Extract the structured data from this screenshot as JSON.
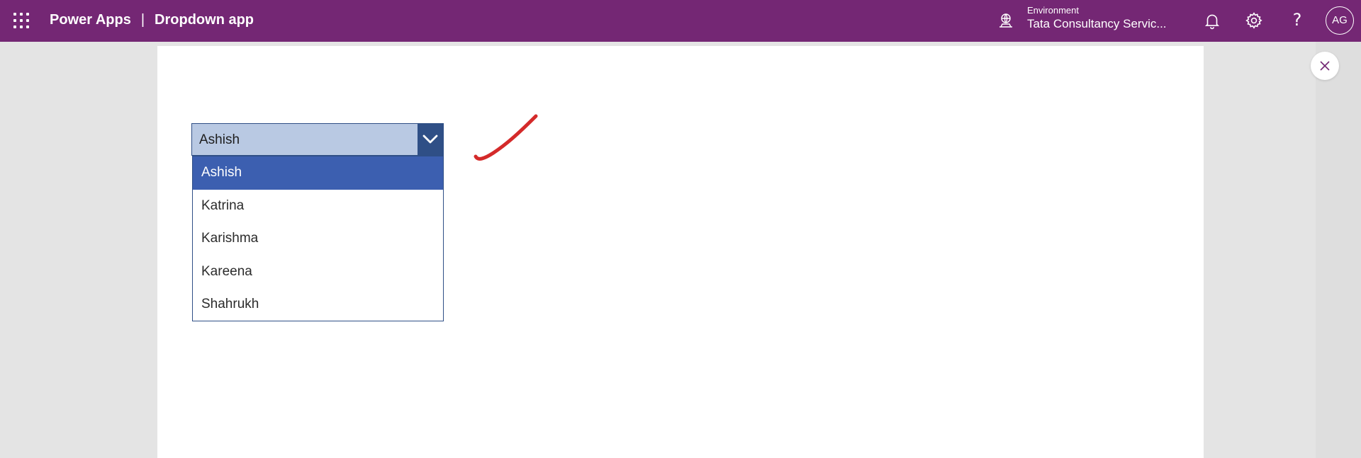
{
  "header": {
    "product": "Power Apps",
    "separator": "|",
    "app_name": "Dropdown app",
    "environment_label": "Environment",
    "environment_name": "Tata Consultancy Servic...",
    "help_glyph": "?",
    "avatar_initials": "AG",
    "icons": [
      "waffle-icon",
      "environment-icon",
      "bell-icon",
      "gear-icon",
      "help-icon"
    ]
  },
  "dropdown": {
    "selected": "Ashish",
    "options": [
      "Ashish",
      "Katrina",
      "Karishma",
      "Kareena",
      "Shahrukh"
    ],
    "highlighted_index": 0
  },
  "colors": {
    "header_bg": "#742774",
    "dropdown_selected_bg": "#b9c9e3",
    "dropdown_border": "#2f4f86",
    "option_highlight": "#3c5fb0",
    "annotation": "#d42a2a"
  }
}
